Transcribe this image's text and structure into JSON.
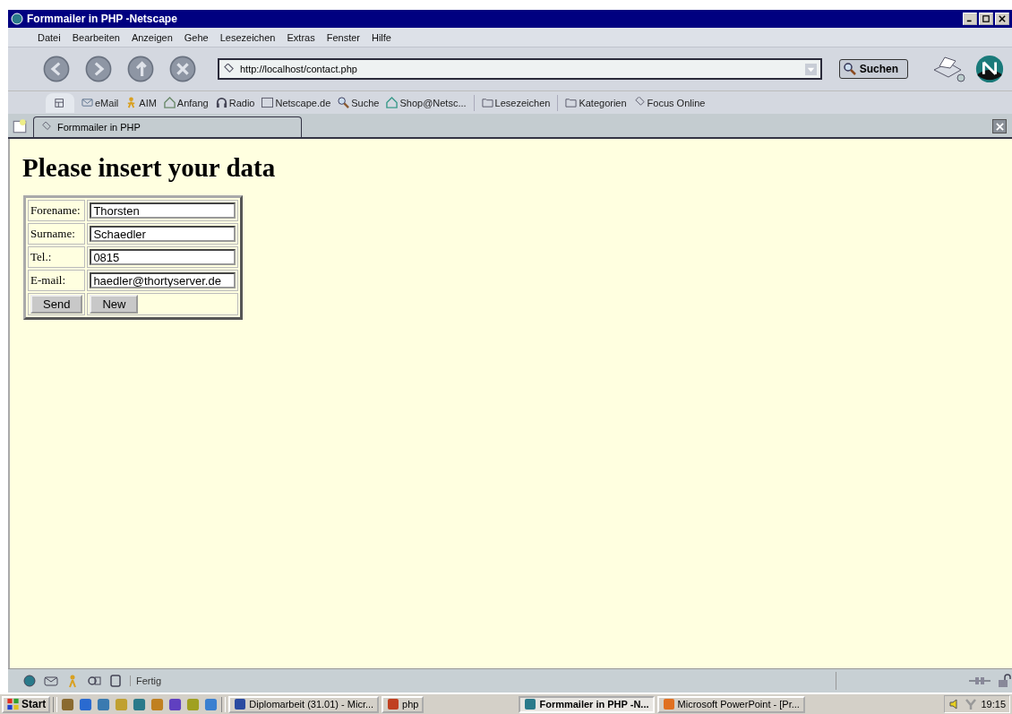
{
  "window": {
    "title": "Formmailer in PHP -Netscape"
  },
  "menu": [
    "Datei",
    "Bearbeiten",
    "Anzeigen",
    "Gehe",
    "Lesezeichen",
    "Extras",
    "Fenster",
    "Hilfe"
  ],
  "navigation": {
    "url": "http://localhost/contact.php",
    "search_button": "Suchen"
  },
  "personal_toolbar": [
    {
      "label": "eMail",
      "kind": "mail"
    },
    {
      "label": "AIM",
      "kind": "aim"
    },
    {
      "label": "Anfang",
      "kind": "home"
    },
    {
      "label": "Radio",
      "kind": "radio"
    },
    {
      "label": "Netscape.de",
      "kind": "my"
    },
    {
      "label": "Suche",
      "kind": "search"
    },
    {
      "label": "Shop@Netsc...",
      "kind": "shop"
    },
    {
      "label": "Lesezeichen",
      "kind": "folder"
    },
    {
      "label": "Kategorien",
      "kind": "folder"
    },
    {
      "label": "Focus Online",
      "kind": "bookmark"
    }
  ],
  "tab": {
    "label": "Formmailer in PHP"
  },
  "page": {
    "heading": "Please insert your data",
    "fields": [
      {
        "label": "Forename:",
        "value": "Thorsten"
      },
      {
        "label": "Surname:",
        "value": "Schaedler"
      },
      {
        "label": "Tel.:",
        "value": "0815"
      },
      {
        "label": "E-mail:",
        "value": "haedler@thortyserver.de"
      }
    ],
    "buttons": [
      "Send",
      "New"
    ]
  },
  "status_bar": {
    "text": "Fertig"
  },
  "taskbar": {
    "start": "Start",
    "tasks": [
      {
        "label": "Diplomarbeit (31.01) - Micr...",
        "kind": "word",
        "selected": false
      },
      {
        "label": "php",
        "kind": "folder",
        "selected": false
      },
      {
        "label": "Formmailer in PHP -N...",
        "kind": "netscape",
        "selected": true
      },
      {
        "label": "Microsoft PowerPoint - [Pr...",
        "kind": "powerpoint",
        "selected": false
      }
    ],
    "clock": "19:15"
  }
}
